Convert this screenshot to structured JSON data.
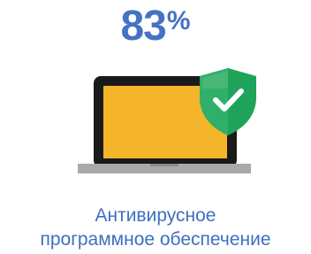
{
  "stat": {
    "number": "83",
    "unit": "%"
  },
  "caption": {
    "line1": "Антивирусное",
    "line2": "программное обеспечение"
  },
  "illustration": {
    "laptop_icon": "laptop-icon",
    "shield_icon": "shield-check-icon"
  },
  "colors": {
    "accent": "#4472c4",
    "screen": "#f5b52a",
    "laptop_frame": "#1a1a1a",
    "laptop_base": "#a9a9a9",
    "shield": "#1fa35a",
    "shield_highlight": "#5bbf83"
  }
}
